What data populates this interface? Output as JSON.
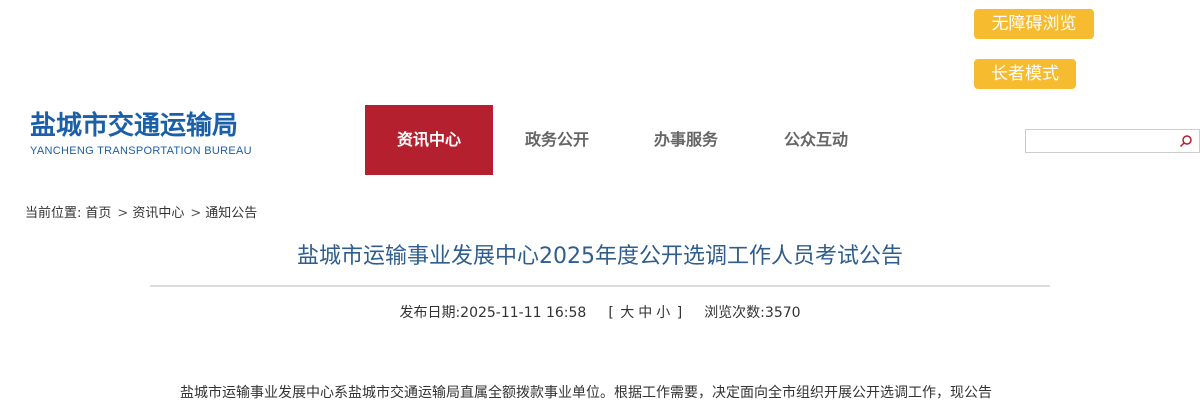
{
  "toolbar": {
    "accessibility_label": "无障碍浏览",
    "elder_mode_label": "长者模式"
  },
  "logo": {
    "cn": "盐城市交通运输局",
    "en": "YANCHENG TRANSPORTATION BUREAU"
  },
  "nav": {
    "items": [
      {
        "label": "资讯中心",
        "active": true
      },
      {
        "label": "政务公开",
        "active": false
      },
      {
        "label": "办事服务",
        "active": false
      },
      {
        "label": "公众互动",
        "active": false
      }
    ]
  },
  "search": {
    "value": "",
    "icon": "search-icon"
  },
  "breadcrumb": {
    "prefix": "当前位置:",
    "items": [
      "首页",
      "资讯中心",
      "通知公告"
    ],
    "separator": ">"
  },
  "article": {
    "title": "盐城市运输事业发展中心2025年度公开选调工作人员考试公告",
    "publish_label": "发布日期:",
    "publish_date": "2025-11-11 16:58",
    "font_size_open": "[",
    "font_size_large": "大",
    "font_size_medium": "中",
    "font_size_small": "小",
    "font_size_close": "]",
    "views_label": "浏览次数:",
    "views": "3570",
    "first_paragraph": "盐城市运输事业发展中心系盐城市交通运输局直属全额拨款事业单位。根据工作需要，决定面向全市组织开展公开选调工作，现公告"
  },
  "colors": {
    "accent_red": "#b5202e",
    "pill_yellow": "#f7bb30",
    "logo_blue": "#1a5fa8",
    "title_blue": "#2e5d8e"
  }
}
